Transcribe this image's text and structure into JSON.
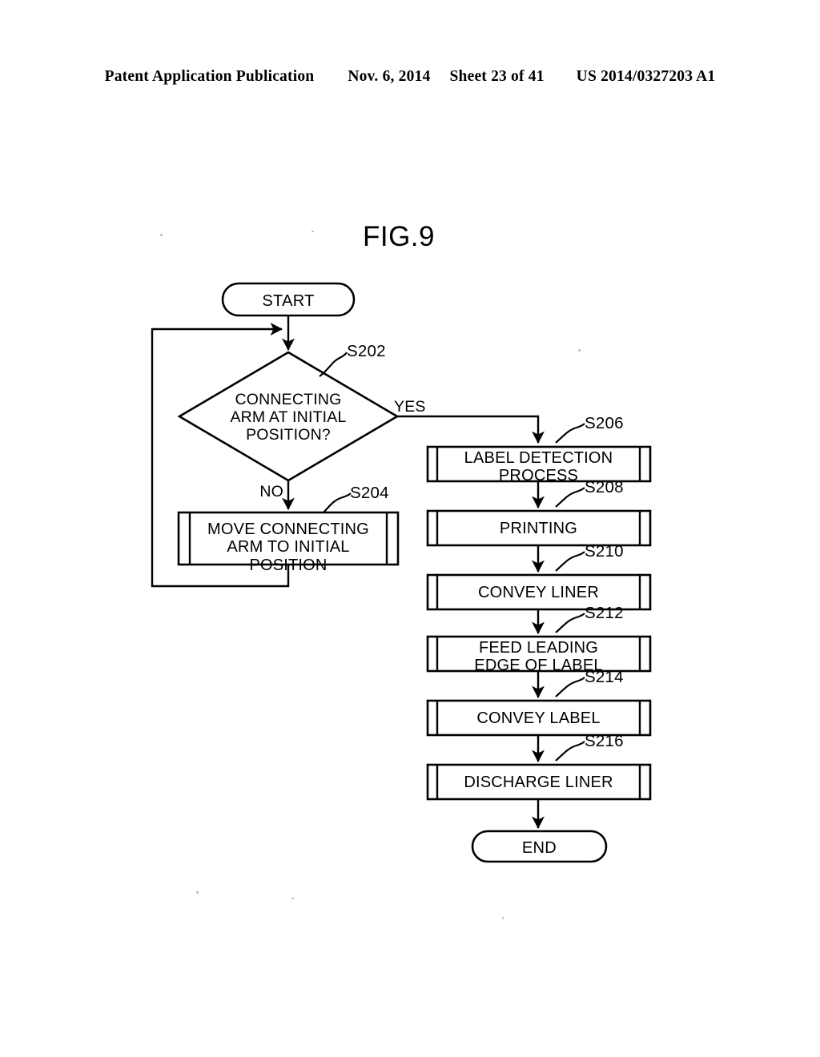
{
  "header": {
    "publication": "Patent Application Publication",
    "date": "Nov. 6, 2014",
    "sheet": "Sheet 23 of 41",
    "number": "US 2014/0327203 A1"
  },
  "figure": {
    "title": "FIG.9"
  },
  "chart_data": {
    "type": "flowchart",
    "title": "FIG.9",
    "orientation": "top-to-bottom",
    "nodes": [
      {
        "id": "start",
        "shape": "terminal",
        "label": "START",
        "ref": ""
      },
      {
        "id": "s202",
        "shape": "decision",
        "label": "CONNECTING\nARM AT INITIAL\nPOSITION?",
        "ref": "S202"
      },
      {
        "id": "s204",
        "shape": "predefined-process",
        "label": "MOVE CONNECTING\nARM TO INITIAL POSITION",
        "ref": "S204"
      },
      {
        "id": "s206",
        "shape": "predefined-process",
        "label": "LABEL DETECTION\nPROCESS",
        "ref": "S206"
      },
      {
        "id": "s208",
        "shape": "predefined-process",
        "label": "PRINTING",
        "ref": "S208"
      },
      {
        "id": "s210",
        "shape": "predefined-process",
        "label": "CONVEY LINER",
        "ref": "S210"
      },
      {
        "id": "s212",
        "shape": "predefined-process",
        "label": "FEED LEADING\nEDGE OF LABEL",
        "ref": "S212"
      },
      {
        "id": "s214",
        "shape": "predefined-process",
        "label": "CONVEY LABEL",
        "ref": "S214"
      },
      {
        "id": "s216",
        "shape": "predefined-process",
        "label": "DISCHARGE LINER",
        "ref": "S216"
      },
      {
        "id": "end",
        "shape": "terminal",
        "label": "END",
        "ref": ""
      }
    ],
    "edges": [
      {
        "from": "start",
        "to": "s202",
        "label": ""
      },
      {
        "from": "s202",
        "to": "s206",
        "label": "YES"
      },
      {
        "from": "s202",
        "to": "s204",
        "label": "NO"
      },
      {
        "from": "s204",
        "to": "s202",
        "label": ""
      },
      {
        "from": "s206",
        "to": "s208",
        "label": ""
      },
      {
        "from": "s208",
        "to": "s210",
        "label": ""
      },
      {
        "from": "s210",
        "to": "s212",
        "label": ""
      },
      {
        "from": "s212",
        "to": "s214",
        "label": ""
      },
      {
        "from": "s214",
        "to": "s216",
        "label": ""
      },
      {
        "from": "s216",
        "to": "end",
        "label": ""
      }
    ],
    "branch_labels": {
      "yes": "YES",
      "no": "NO"
    },
    "colors": {
      "line": "#000000",
      "background": "#ffffff",
      "text": "#000000"
    }
  },
  "nodes": {
    "start": {
      "label": "START"
    },
    "s202": {
      "label": "CONNECTING\nARM AT INITIAL\nPOSITION?",
      "ref": "S202"
    },
    "s204": {
      "label": "MOVE CONNECTING\nARM TO INITIAL POSITION",
      "ref": "S204"
    },
    "s206": {
      "label": "LABEL DETECTION\nPROCESS",
      "ref": "S206"
    },
    "s208": {
      "label": "PRINTING",
      "ref": "S208"
    },
    "s210": {
      "label": "CONVEY LINER",
      "ref": "S210"
    },
    "s212": {
      "label": "FEED LEADING\nEDGE OF LABEL",
      "ref": "S212"
    },
    "s214": {
      "label": "CONVEY LABEL",
      "ref": "S214"
    },
    "s216": {
      "label": "DISCHARGE LINER",
      "ref": "S216"
    },
    "end": {
      "label": "END"
    }
  },
  "branches": {
    "yes": "YES",
    "no": "NO"
  }
}
